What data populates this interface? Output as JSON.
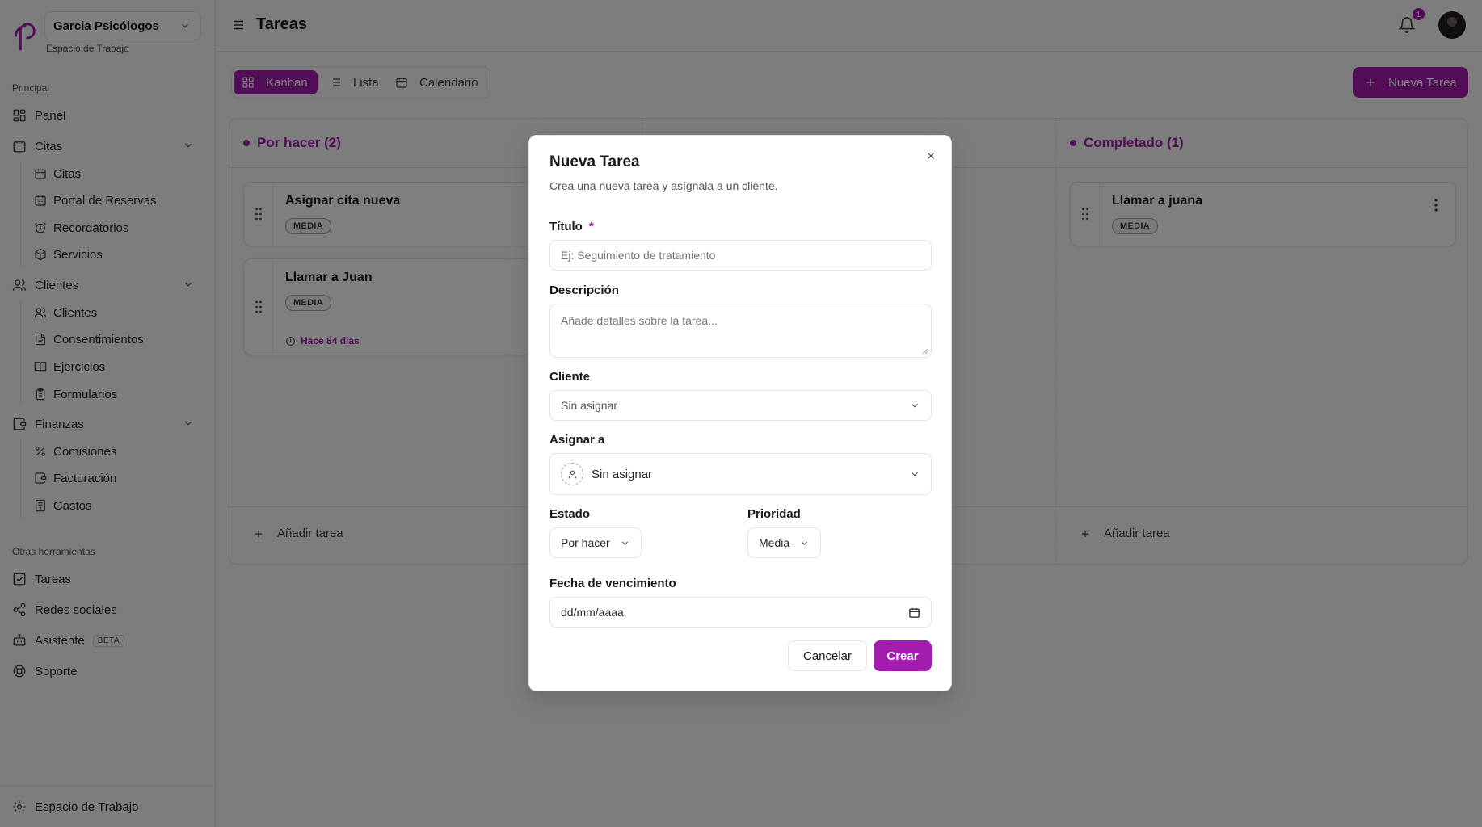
{
  "workspace": {
    "name": "Garcia Psicólogos",
    "subtitle": "Espacio de Trabajo"
  },
  "sidebar": {
    "group_main": "Principal",
    "panel": "Panel",
    "citas": {
      "label": "Citas",
      "items": [
        "Citas",
        "Portal de Reservas",
        "Recordatorios",
        "Servicios"
      ]
    },
    "clientes": {
      "label": "Clientes",
      "items": [
        "Clientes",
        "Consentimientos",
        "Ejercicios",
        "Formularios"
      ]
    },
    "finanzas": {
      "label": "Finanzas",
      "items": [
        "Comisiones",
        "Facturación",
        "Gastos"
      ]
    },
    "group_other": "Otras herramientas",
    "tareas": "Tareas",
    "redes": "Redes sociales",
    "asistente": "Asistente",
    "beta": "BETA",
    "soporte": "Soporte",
    "footer": "Espacio de Trabajo"
  },
  "topbar": {
    "title": "Tareas",
    "notif_count": "1"
  },
  "views": {
    "kanban": "Kanban",
    "lista": "Lista",
    "calendario": "Calendario"
  },
  "new_task_label": "Nueva Tarea",
  "board": {
    "todo": {
      "header": "Por hacer (2)",
      "cards": [
        {
          "title": "Asignar cita nueva",
          "priority": "MEDIA"
        },
        {
          "title": "Llamar a Juan",
          "priority": "MEDIA",
          "due": "Hace 84 dias"
        }
      ],
      "add_label": "Añadir tarea"
    },
    "done": {
      "header": "Completado (1)",
      "cards": [
        {
          "title": "Llamar a juana",
          "priority": "MEDIA"
        }
      ],
      "add_label": "Añadir tarea"
    }
  },
  "modal": {
    "title": "Nueva Tarea",
    "subtitle": "Crea una nueva tarea y asígnala a un cliente.",
    "titulo_label": "Título",
    "required_mark": "*",
    "titulo_placeholder": "Ej: Seguimiento de tratamiento",
    "descripcion_label": "Descripción",
    "descripcion_placeholder": "Añade detalles sobre la tarea...",
    "cliente_label": "Cliente",
    "cliente_value": "Sin asignar",
    "asignar_label": "Asignar a",
    "asignar_value": "Sin asignar",
    "estado_label": "Estado",
    "estado_value": "Por hacer",
    "prioridad_label": "Prioridad",
    "prioridad_value": "Media",
    "fecha_label": "Fecha de vencimiento",
    "fecha_placeholder": "dd/mm/aaaa",
    "cancel": "Cancelar",
    "create": "Crear"
  },
  "colors": {
    "accent": "#a21caf",
    "border": "#e4e4e7",
    "overlay": "rgba(0,0,0,0.5)"
  }
}
